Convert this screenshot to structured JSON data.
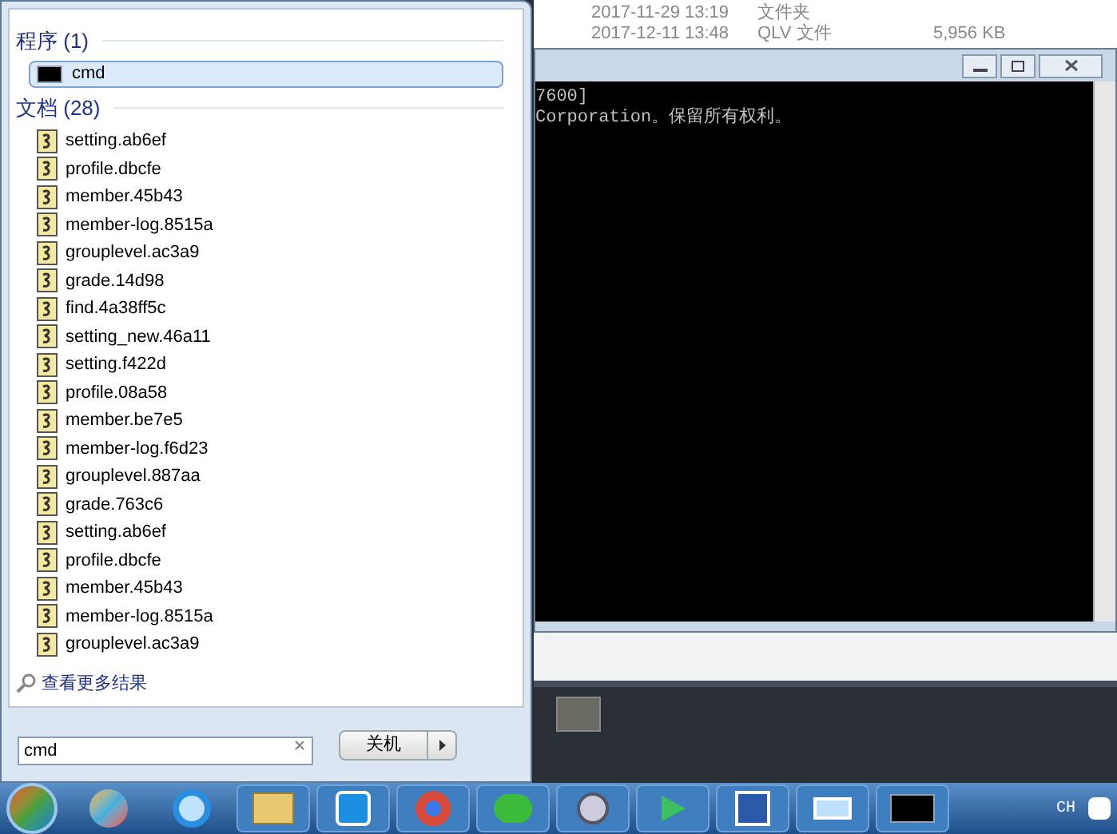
{
  "background_window": {
    "rows": [
      {
        "date": "2017-11-29  13:19",
        "type": "文件夹",
        "size": ""
      },
      {
        "date": "2017-12-11  13:48",
        "type": "QLV 文件",
        "size": "5,956 KB"
      }
    ]
  },
  "console": {
    "lines": [
      "7600]",
      "Corporation。保留所有权利。"
    ]
  },
  "start_menu": {
    "groups": [
      {
        "title": "程序 (1)",
        "kind": "program",
        "items": [
          {
            "label": "cmd",
            "selected": true
          }
        ]
      },
      {
        "title": "文档 (28)",
        "kind": "document",
        "items": [
          {
            "label": "setting.ab6ef",
            "selected": false
          },
          {
            "label": "profile.dbcfe",
            "selected": false
          },
          {
            "label": "member.45b43",
            "selected": false
          },
          {
            "label": "member-log.8515a",
            "selected": false
          },
          {
            "label": "grouplevel.ac3a9",
            "selected": false
          },
          {
            "label": "grade.14d98",
            "selected": false
          },
          {
            "label": "find.4a38ff5c",
            "selected": false
          },
          {
            "label": "setting_new.46a11",
            "selected": false
          },
          {
            "label": "setting.f422d",
            "selected": false
          },
          {
            "label": "profile.08a58",
            "selected": false
          },
          {
            "label": "member.be7e5",
            "selected": false
          },
          {
            "label": "member-log.f6d23",
            "selected": false
          },
          {
            "label": "grouplevel.887aa",
            "selected": false
          },
          {
            "label": "grade.763c6",
            "selected": false
          },
          {
            "label": "setting.ab6ef",
            "selected": false
          },
          {
            "label": "profile.dbcfe",
            "selected": false
          },
          {
            "label": "member.45b43",
            "selected": false
          },
          {
            "label": "member-log.8515a",
            "selected": false
          },
          {
            "label": "grouplevel.ac3a9",
            "selected": false
          }
        ]
      }
    ],
    "more_results": "查看更多结果",
    "search": {
      "value": "cmd"
    },
    "shutdown_button": "关机"
  },
  "taskbar": {
    "language": "CH"
  }
}
